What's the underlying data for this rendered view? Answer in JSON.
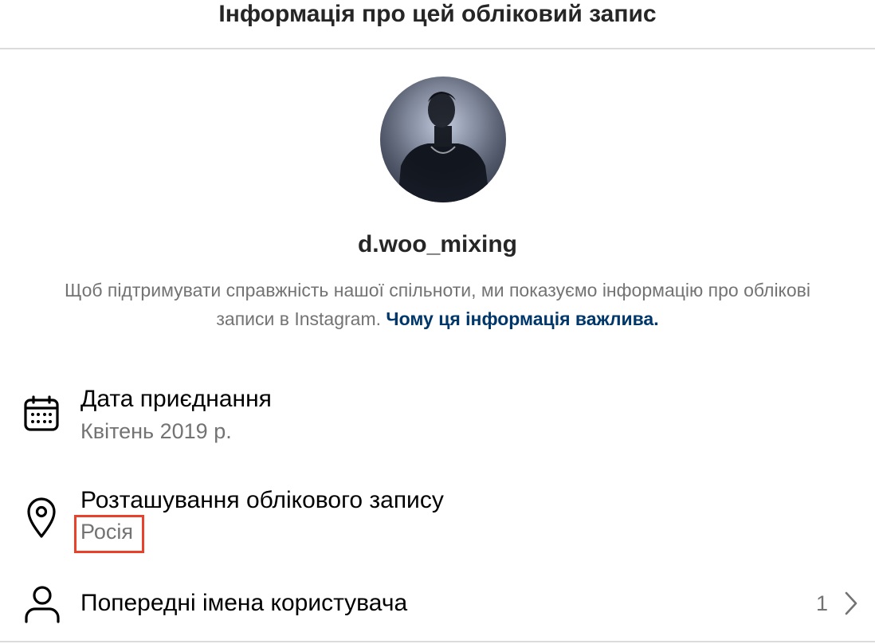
{
  "header": {
    "title": "Інформація про цей обліковий запис"
  },
  "profile": {
    "username": "d.woo_mixing"
  },
  "description": {
    "text": "Щоб підтримувати справжність нашої спільноти, ми показуємо інформацію про облікові записи в Instagram.",
    "link": "Чому ця інформація важлива."
  },
  "rows": {
    "date_joined": {
      "title": "Дата приєднання",
      "value": "Квітень 2019 р.",
      "icon": "calendar-icon"
    },
    "location": {
      "title": "Розташування облікового запису",
      "value": "Росія",
      "icon": "location-pin-icon"
    },
    "former_usernames": {
      "title": "Попередні імена користувача",
      "count": "1",
      "icon": "user-icon"
    }
  },
  "colors": {
    "link": "#00376b",
    "secondary_text": "#737373",
    "highlight": "#e8422c",
    "divider": "#dbdbdb"
  }
}
